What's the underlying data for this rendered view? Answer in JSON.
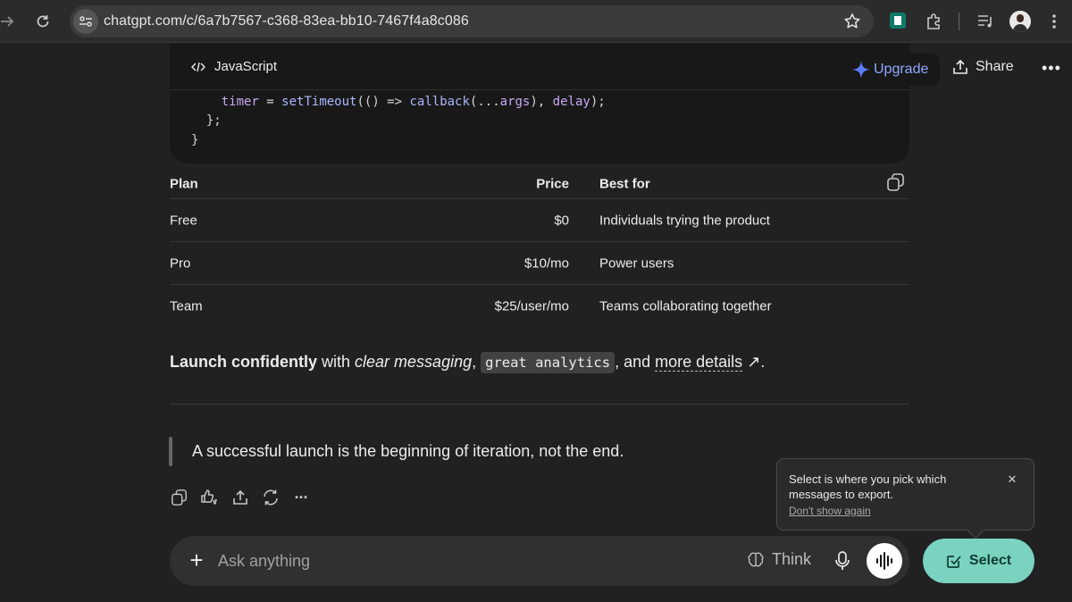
{
  "browser": {
    "url": "chatgpt.com/c/6a7b7567-c368-83ea-bb10-7467f4a8c086",
    "back_icon": "arrow-right-icon",
    "reload_icon": "reload-icon"
  },
  "header": {
    "upgrade_label": "Upgrade",
    "share_label": "Share",
    "more_label": "•••"
  },
  "code_block": {
    "language": "JavaScript",
    "lines": [
      {
        "indent": "    ",
        "parts": [
          [
            "var",
            "timer"
          ],
          [
            "plain",
            " = "
          ],
          [
            "fn",
            "setTimeout"
          ],
          [
            "plain",
            "(() => "
          ],
          [
            "fn",
            "callback"
          ],
          [
            "plain",
            "(..."
          ],
          [
            "var",
            "args"
          ],
          [
            "plain",
            "), "
          ],
          [
            "var",
            "delay"
          ],
          [
            "plain",
            ");"
          ]
        ]
      },
      {
        "indent": "  ",
        "parts": [
          [
            "plain",
            "};"
          ]
        ]
      },
      {
        "indent": "",
        "parts": [
          [
            "plain",
            "}"
          ]
        ]
      }
    ]
  },
  "table": {
    "headers": [
      "Plan",
      "Price",
      "Best for"
    ],
    "rows": [
      [
        "Free",
        "$0",
        "Individuals trying the product"
      ],
      [
        "Pro",
        "$10/mo",
        "Power users"
      ],
      [
        "Team",
        "$25/user/mo",
        "Teams collaborating together"
      ]
    ]
  },
  "paragraph": {
    "bold": "Launch confidently",
    "t1": " with ",
    "italic": "clear messaging",
    "t2": ", ",
    "code": "great analytics",
    "t3": ", and ",
    "link": "more details",
    "link_arrow": "↗",
    "t4": "."
  },
  "quote": "A successful launch is the beginning of iteration, not the end.",
  "message_actions": {
    "more_label": "···"
  },
  "tooltip": {
    "text": "Select is where you pick which messages to export.",
    "dont_show": "Don't show again",
    "close": "✕"
  },
  "composer": {
    "plus": "+",
    "placeholder": "Ask anything",
    "think_label": "Think"
  },
  "select_button": {
    "label": "Select"
  },
  "colors": {
    "accent": "#7ad3c1",
    "upgrade": "#8fa8ff",
    "background": "#212121"
  }
}
